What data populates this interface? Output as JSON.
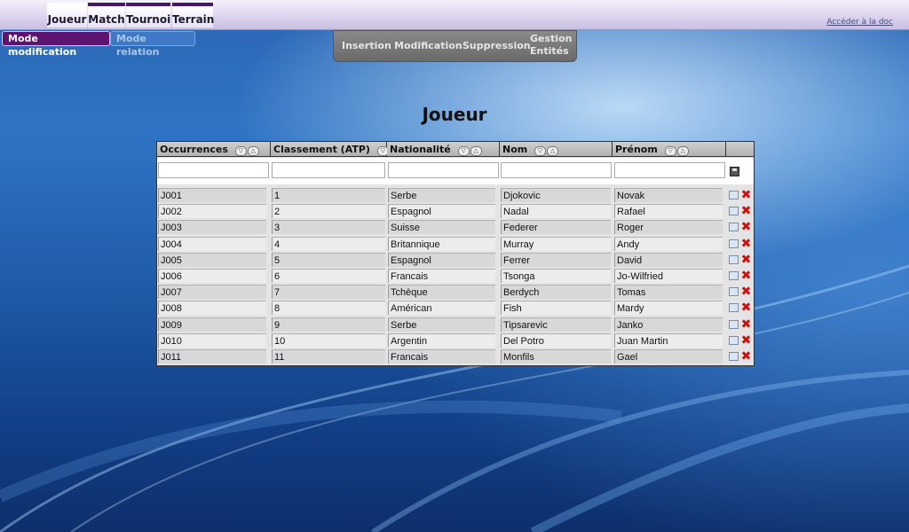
{
  "nav": {
    "tabs": [
      {
        "label": "Joueur"
      },
      {
        "label": "Match"
      },
      {
        "label": "Tournoi"
      },
      {
        "label": "Terrain"
      }
    ],
    "doc_link": "Accéder à la doc"
  },
  "modes": {
    "modification": "Mode modification",
    "relation": "Mode relation"
  },
  "actions": {
    "insertion": "Insertion",
    "modification": "Modification",
    "suppression": "Suppression",
    "gestion_line1": "Gestion",
    "gestion_line2": "Entités"
  },
  "page": {
    "title": "Joueur"
  },
  "table": {
    "columns": [
      "Occurrences",
      "Classement (ATP)",
      "Nationalité",
      "Nom",
      "Prénom"
    ],
    "rows": [
      [
        "J001",
        "1",
        "Serbe",
        "Djokovic",
        "Novak"
      ],
      [
        "J002",
        "2",
        "Espagnol",
        "Nadal",
        "Rafael"
      ],
      [
        "J003",
        "3",
        "Suisse",
        "Federer",
        "Roger"
      ],
      [
        "J004",
        "4",
        "Britannique",
        "Murray",
        "Andy"
      ],
      [
        "J005",
        "5",
        "Espagnol",
        "Ferrer",
        "David"
      ],
      [
        "J006",
        "6",
        "Francais",
        "Tsonga",
        "Jo-Wilfried"
      ],
      [
        "J007",
        "7",
        "Tchèque",
        "Berdych",
        "Tomas"
      ],
      [
        "J008",
        "8",
        "Américan",
        "Fish",
        "Mardy"
      ],
      [
        "J009",
        "9",
        "Serbe",
        "Tipsarevic",
        "Janko"
      ],
      [
        "J010",
        "10",
        "Argentin",
        "Del Potro",
        "Juan Martin"
      ],
      [
        "J011",
        "11",
        "Francais",
        "Monfils",
        "Gael"
      ]
    ]
  }
}
